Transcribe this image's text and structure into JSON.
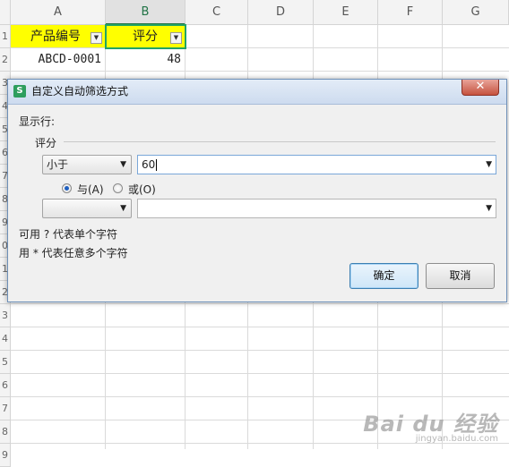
{
  "sheet": {
    "columns": [
      "A",
      "B",
      "C",
      "D",
      "E",
      "F",
      "G"
    ],
    "rows": [
      "1",
      "2",
      "3",
      "4",
      "5",
      "6",
      "7",
      "8",
      "9",
      "0",
      "1",
      "2",
      "3",
      "4",
      "5",
      "6",
      "7",
      "8",
      "9"
    ],
    "header_cells": {
      "a1": "产品编号",
      "b1": "评分"
    },
    "data_cells": {
      "a2": "ABCD-0001",
      "b2": "48"
    },
    "filter_button_glyph": "▼",
    "colors": {
      "header_fill": "#ffff00",
      "selection": "#21a366"
    }
  },
  "dialog": {
    "title": "自定义自动筛选方式",
    "app_icon_letter": "S",
    "close_glyph": "✕",
    "show_rows_label": "显示行:",
    "field_label": "评分",
    "condition1": {
      "operator": "小于",
      "value": "60"
    },
    "connector": {
      "and_label": "与(A)",
      "or_label": "或(O)",
      "selected": "and"
    },
    "condition2": {
      "operator": "",
      "value": ""
    },
    "hint1": "可用 ? 代表单个字符",
    "hint2": "用 * 代表任意多个字符",
    "ok_label": "确定",
    "cancel_label": "取消",
    "dropdown_glyph": "▼"
  },
  "watermark": {
    "main": "Bai du 经验",
    "sub": "jingyan.baidu.com"
  }
}
